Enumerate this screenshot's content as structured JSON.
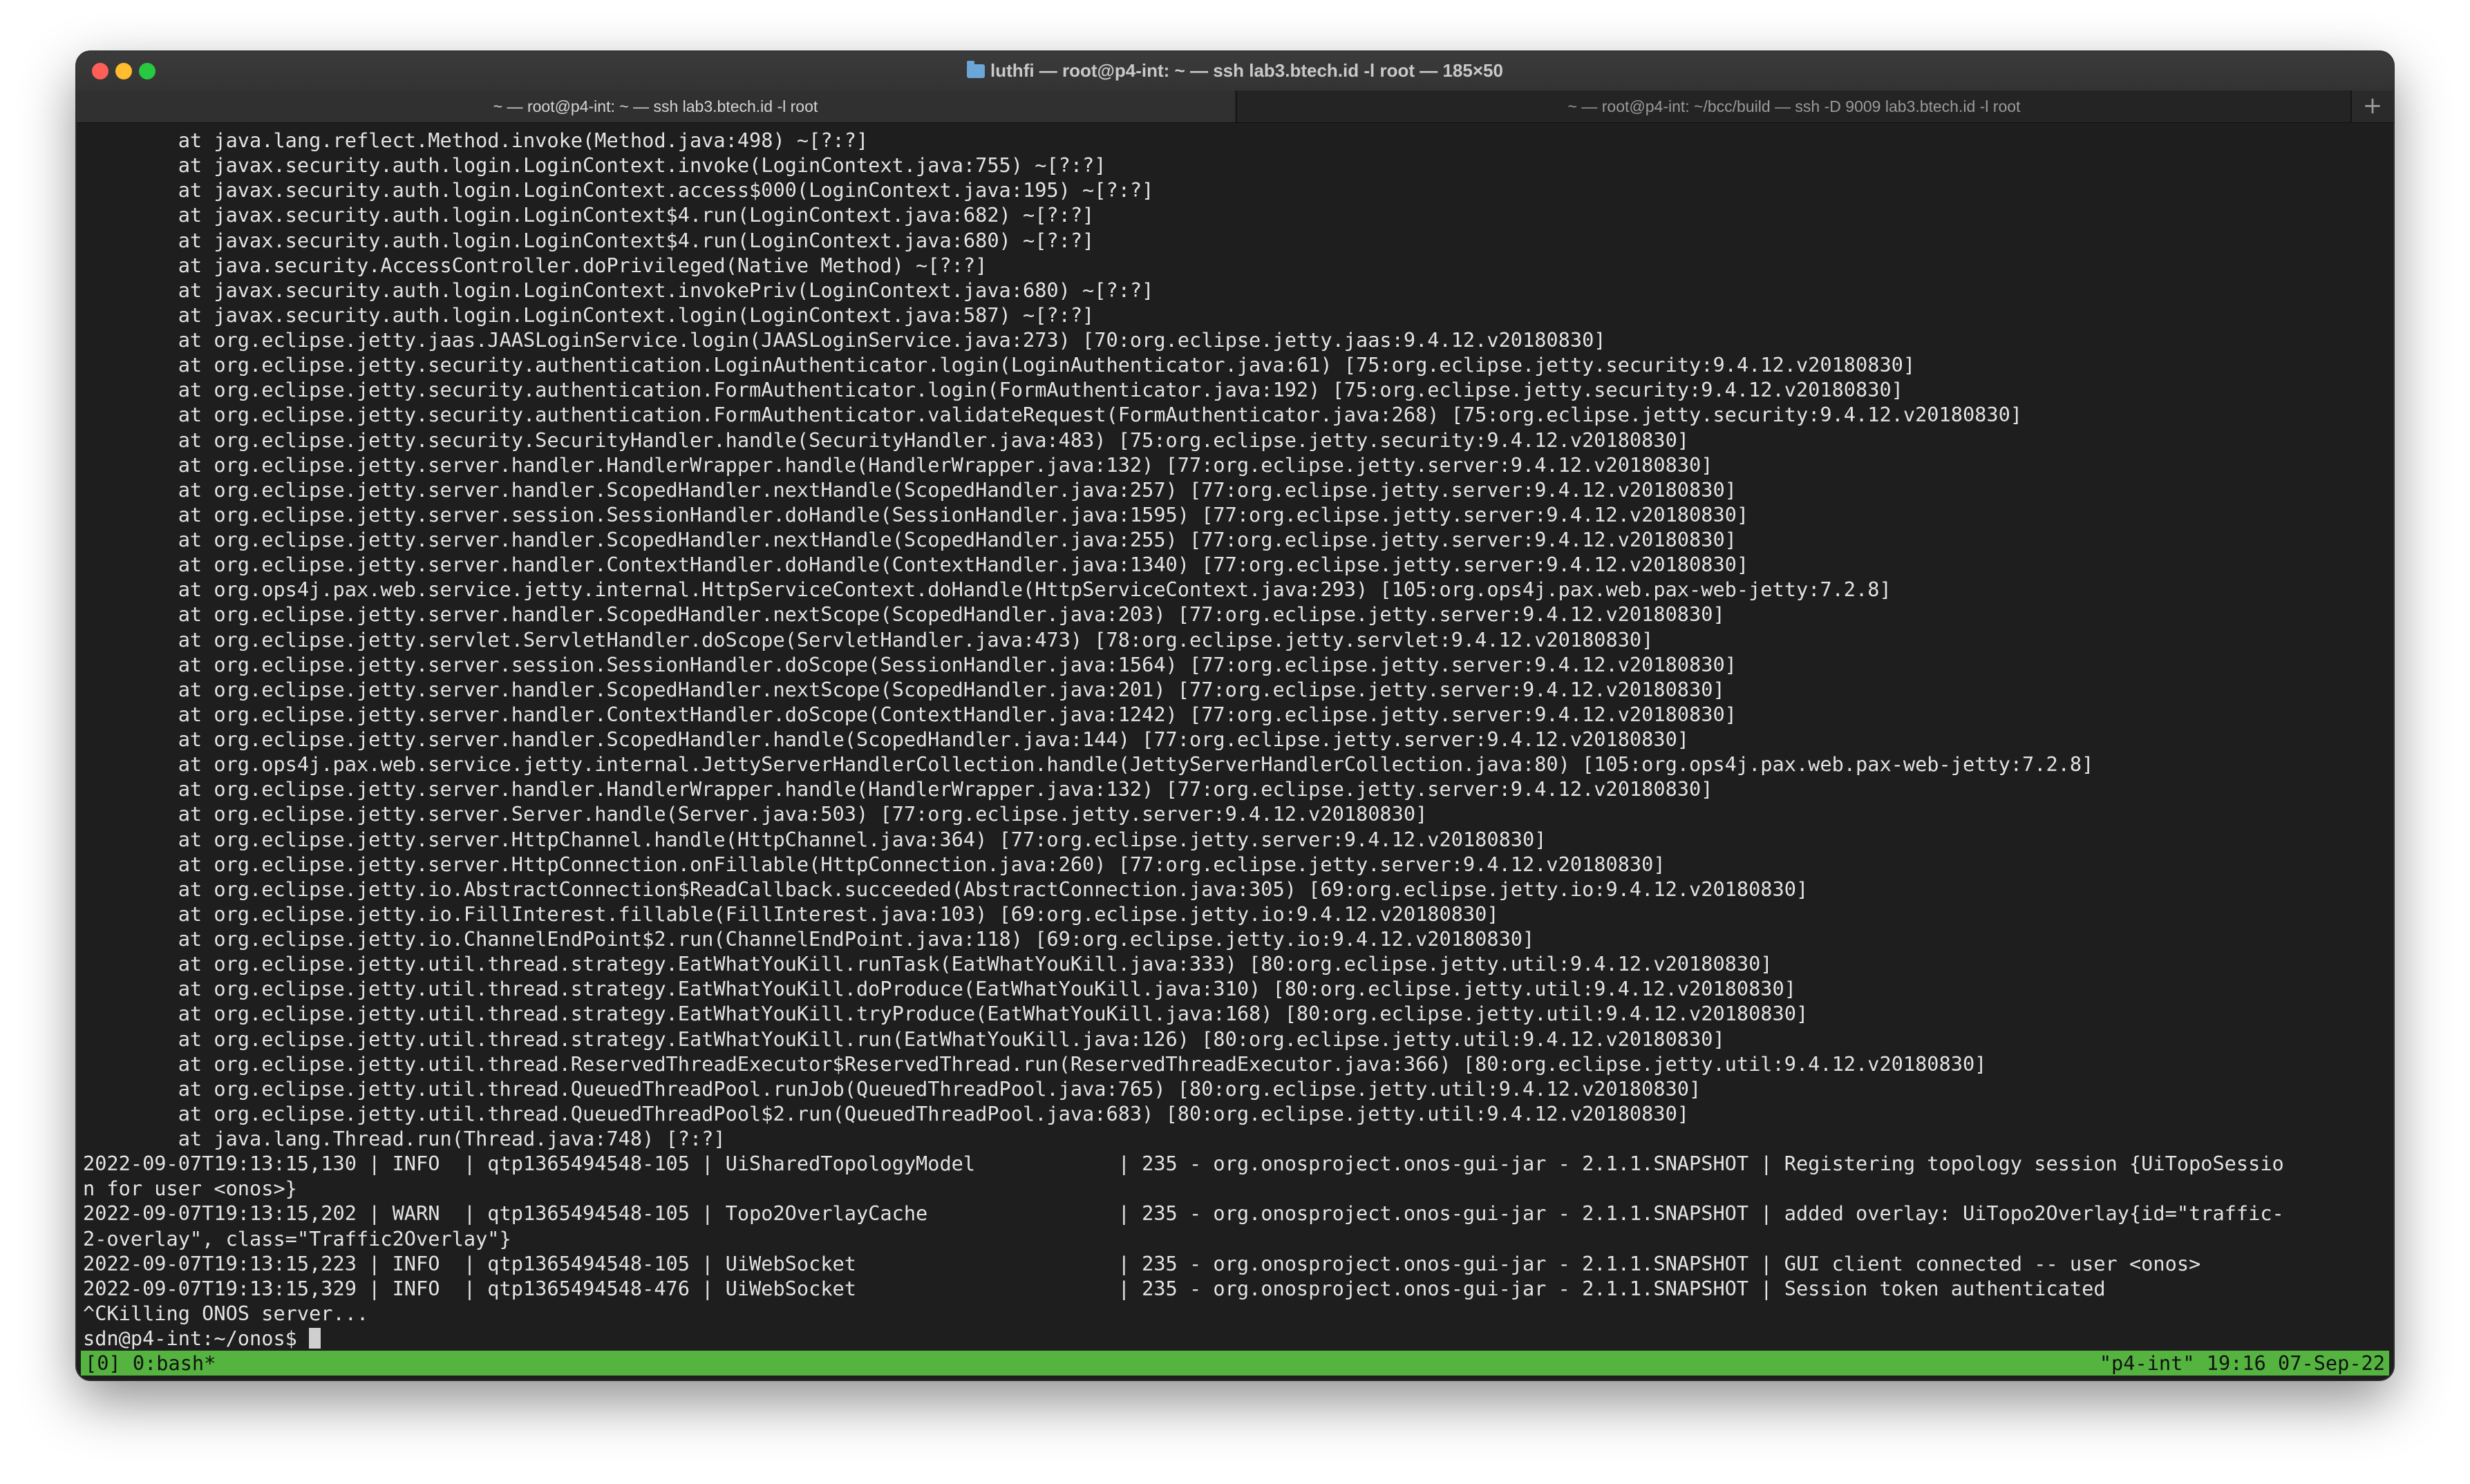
{
  "window": {
    "title": "luthfi — root@p4-int: ~ — ssh lab3.btech.id -l root — 185×50"
  },
  "tabs": [
    {
      "label": "~ — root@p4-int: ~ — ssh lab3.btech.id -l root",
      "active": true
    },
    {
      "label": "~ — root@p4-int: ~/bcc/build — ssh -D 9009 lab3.btech.id -l root",
      "active": false
    }
  ],
  "new_tab_label": "+",
  "terminal": {
    "lines": [
      "        at java.lang.reflect.Method.invoke(Method.java:498) ~[?:?]",
      "        at javax.security.auth.login.LoginContext.invoke(LoginContext.java:755) ~[?:?]",
      "        at javax.security.auth.login.LoginContext.access$000(LoginContext.java:195) ~[?:?]",
      "        at javax.security.auth.login.LoginContext$4.run(LoginContext.java:682) ~[?:?]",
      "        at javax.security.auth.login.LoginContext$4.run(LoginContext.java:680) ~[?:?]",
      "        at java.security.AccessController.doPrivileged(Native Method) ~[?:?]",
      "        at javax.security.auth.login.LoginContext.invokePriv(LoginContext.java:680) ~[?:?]",
      "        at javax.security.auth.login.LoginContext.login(LoginContext.java:587) ~[?:?]",
      "        at org.eclipse.jetty.jaas.JAASLoginService.login(JAASLoginService.java:273) [70:org.eclipse.jetty.jaas:9.4.12.v20180830]",
      "        at org.eclipse.jetty.security.authentication.LoginAuthenticator.login(LoginAuthenticator.java:61) [75:org.eclipse.jetty.security:9.4.12.v20180830]",
      "        at org.eclipse.jetty.security.authentication.FormAuthenticator.login(FormAuthenticator.java:192) [75:org.eclipse.jetty.security:9.4.12.v20180830]",
      "        at org.eclipse.jetty.security.authentication.FormAuthenticator.validateRequest(FormAuthenticator.java:268) [75:org.eclipse.jetty.security:9.4.12.v20180830]",
      "        at org.eclipse.jetty.security.SecurityHandler.handle(SecurityHandler.java:483) [75:org.eclipse.jetty.security:9.4.12.v20180830]",
      "        at org.eclipse.jetty.server.handler.HandlerWrapper.handle(HandlerWrapper.java:132) [77:org.eclipse.jetty.server:9.4.12.v20180830]",
      "        at org.eclipse.jetty.server.handler.ScopedHandler.nextHandle(ScopedHandler.java:257) [77:org.eclipse.jetty.server:9.4.12.v20180830]",
      "        at org.eclipse.jetty.server.session.SessionHandler.doHandle(SessionHandler.java:1595) [77:org.eclipse.jetty.server:9.4.12.v20180830]",
      "        at org.eclipse.jetty.server.handler.ScopedHandler.nextHandle(ScopedHandler.java:255) [77:org.eclipse.jetty.server:9.4.12.v20180830]",
      "        at org.eclipse.jetty.server.handler.ContextHandler.doHandle(ContextHandler.java:1340) [77:org.eclipse.jetty.server:9.4.12.v20180830]",
      "        at org.ops4j.pax.web.service.jetty.internal.HttpServiceContext.doHandle(HttpServiceContext.java:293) [105:org.ops4j.pax.web.pax-web-jetty:7.2.8]",
      "        at org.eclipse.jetty.server.handler.ScopedHandler.nextScope(ScopedHandler.java:203) [77:org.eclipse.jetty.server:9.4.12.v20180830]",
      "        at org.eclipse.jetty.servlet.ServletHandler.doScope(ServletHandler.java:473) [78:org.eclipse.jetty.servlet:9.4.12.v20180830]",
      "        at org.eclipse.jetty.server.session.SessionHandler.doScope(SessionHandler.java:1564) [77:org.eclipse.jetty.server:9.4.12.v20180830]",
      "        at org.eclipse.jetty.server.handler.ScopedHandler.nextScope(ScopedHandler.java:201) [77:org.eclipse.jetty.server:9.4.12.v20180830]",
      "        at org.eclipse.jetty.server.handler.ContextHandler.doScope(ContextHandler.java:1242) [77:org.eclipse.jetty.server:9.4.12.v20180830]",
      "        at org.eclipse.jetty.server.handler.ScopedHandler.handle(ScopedHandler.java:144) [77:org.eclipse.jetty.server:9.4.12.v20180830]",
      "        at org.ops4j.pax.web.service.jetty.internal.JettyServerHandlerCollection.handle(JettyServerHandlerCollection.java:80) [105:org.ops4j.pax.web.pax-web-jetty:7.2.8]",
      "        at org.eclipse.jetty.server.handler.HandlerWrapper.handle(HandlerWrapper.java:132) [77:org.eclipse.jetty.server:9.4.12.v20180830]",
      "        at org.eclipse.jetty.server.Server.handle(Server.java:503) [77:org.eclipse.jetty.server:9.4.12.v20180830]",
      "        at org.eclipse.jetty.server.HttpChannel.handle(HttpChannel.java:364) [77:org.eclipse.jetty.server:9.4.12.v20180830]",
      "        at org.eclipse.jetty.server.HttpConnection.onFillable(HttpConnection.java:260) [77:org.eclipse.jetty.server:9.4.12.v20180830]",
      "        at org.eclipse.jetty.io.AbstractConnection$ReadCallback.succeeded(AbstractConnection.java:305) [69:org.eclipse.jetty.io:9.4.12.v20180830]",
      "        at org.eclipse.jetty.io.FillInterest.fillable(FillInterest.java:103) [69:org.eclipse.jetty.io:9.4.12.v20180830]",
      "        at org.eclipse.jetty.io.ChannelEndPoint$2.run(ChannelEndPoint.java:118) [69:org.eclipse.jetty.io:9.4.12.v20180830]",
      "        at org.eclipse.jetty.util.thread.strategy.EatWhatYouKill.runTask(EatWhatYouKill.java:333) [80:org.eclipse.jetty.util:9.4.12.v20180830]",
      "        at org.eclipse.jetty.util.thread.strategy.EatWhatYouKill.doProduce(EatWhatYouKill.java:310) [80:org.eclipse.jetty.util:9.4.12.v20180830]",
      "        at org.eclipse.jetty.util.thread.strategy.EatWhatYouKill.tryProduce(EatWhatYouKill.java:168) [80:org.eclipse.jetty.util:9.4.12.v20180830]",
      "        at org.eclipse.jetty.util.thread.strategy.EatWhatYouKill.run(EatWhatYouKill.java:126) [80:org.eclipse.jetty.util:9.4.12.v20180830]",
      "        at org.eclipse.jetty.util.thread.ReservedThreadExecutor$ReservedThread.run(ReservedThreadExecutor.java:366) [80:org.eclipse.jetty.util:9.4.12.v20180830]",
      "        at org.eclipse.jetty.util.thread.QueuedThreadPool.runJob(QueuedThreadPool.java:765) [80:org.eclipse.jetty.util:9.4.12.v20180830]",
      "        at org.eclipse.jetty.util.thread.QueuedThreadPool$2.run(QueuedThreadPool.java:683) [80:org.eclipse.jetty.util:9.4.12.v20180830]",
      "        at java.lang.Thread.run(Thread.java:748) [?:?]",
      "2022-09-07T19:13:15,130 | INFO  | qtp1365494548-105 | UiSharedTopologyModel            | 235 - org.onosproject.onos-gui-jar - 2.1.1.SNAPSHOT | Registering topology session {UiTopoSessio",
      "n for user <onos>}",
      "2022-09-07T19:13:15,202 | WARN  | qtp1365494548-105 | Topo2OverlayCache                | 235 - org.onosproject.onos-gui-jar - 2.1.1.SNAPSHOT | added overlay: UiTopo2Overlay{id=\"traffic-",
      "2-overlay\", class=\"Traffic2Overlay\"}",
      "2022-09-07T19:13:15,223 | INFO  | qtp1365494548-105 | UiWebSocket                      | 235 - org.onosproject.onos-gui-jar - 2.1.1.SNAPSHOT | GUI client connected -- user <onos>",
      "2022-09-07T19:13:15,329 | INFO  | qtp1365494548-476 | UiWebSocket                      | 235 - org.onosproject.onos-gui-jar - 2.1.1.SNAPSHOT | Session token authenticated",
      "^CKilling ONOS server..."
    ],
    "prompt": "sdn@p4-int:~/onos$ "
  },
  "tmux": {
    "left": "[0] 0:bash*",
    "right": "\"p4-int\" 19:16 07-Sep-22",
    "color": "#54b43f"
  }
}
